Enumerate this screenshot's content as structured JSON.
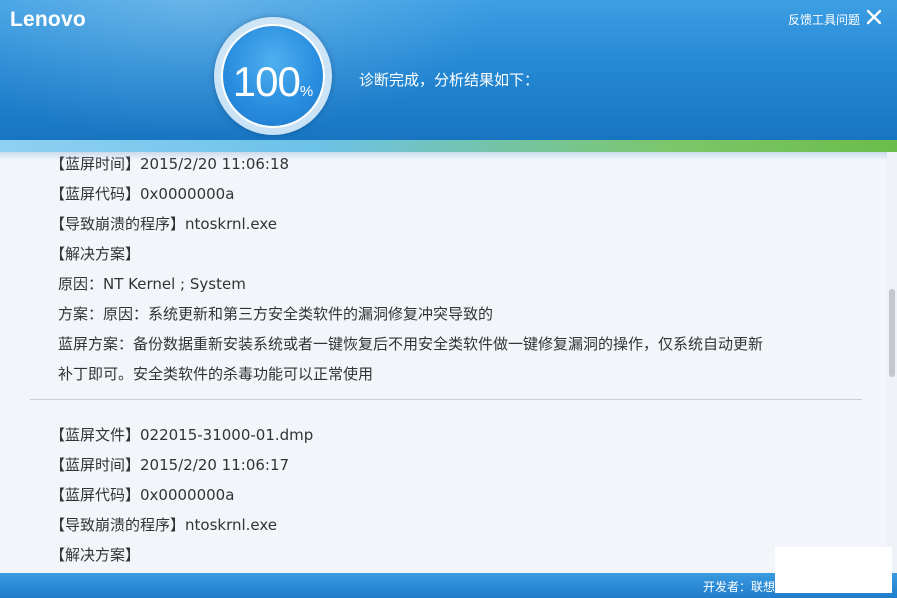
{
  "header": {
    "logo": "Lenovo",
    "feedback_label": "反馈工具问题",
    "progress_value": "100",
    "progress_unit": "%",
    "progress_fraction": 1.0,
    "status_text": "诊断完成，分析结果如下："
  },
  "records": [
    {
      "lines": [
        "【蓝屏时间】2015/2/20 11:06:18",
        "【蓝屏代码】0x0000000a",
        "【导致崩溃的程序】ntoskrnl.exe",
        "【解决方案】"
      ],
      "solution": [
        "原因：NT Kernel ; System",
        "方案：原因：系统更新和第三方安全类软件的漏洞修复冲突导致的",
        "蓝屏方案：备份数据重新安装系统或者一键恢复后不用安全类软件做一键修复漏洞的操作，仅系统自动更新",
        "补丁即可。安全类软件的杀毒功能可以正常使用"
      ]
    },
    {
      "lines": [
        "【蓝屏文件】022015-31000-01.dmp",
        "【蓝屏时间】2015/2/20 11:06:17",
        "【蓝屏代码】0x0000000a",
        "【导致崩溃的程序】ntoskrnl.exe",
        "【解决方案】"
      ]
    }
  ],
  "footer": {
    "developer_label": "开发者：联想"
  },
  "colors": {
    "header_blue": "#2589d4",
    "accent_green": "#6bbd4a",
    "text": "#333333"
  }
}
